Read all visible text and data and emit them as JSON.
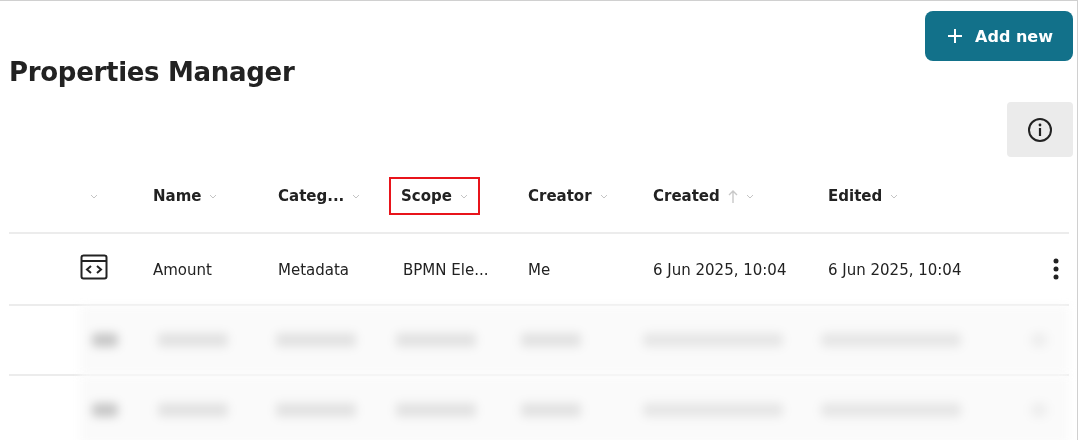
{
  "page": {
    "title": "Properties Manager"
  },
  "add_button": {
    "label": "Add new"
  },
  "table": {
    "columns": [
      {
        "sorted": false,
        "highlighted": false
      },
      {
        "label": "Name",
        "sorted": false,
        "highlighted": false
      },
      {
        "label": "Categ...",
        "sorted": false,
        "highlighted": false
      },
      {
        "label": "Scope",
        "sorted": false,
        "highlighted": true
      },
      {
        "label": "Creator",
        "sorted": false,
        "highlighted": false
      },
      {
        "label": "Created",
        "sorted": true,
        "highlighted": false
      },
      {
        "label": "Edited",
        "sorted": false,
        "highlighted": false
      }
    ],
    "rows": [
      {
        "kind": "data",
        "cells": [
          "Amount",
          "Metadata",
          "BPMN Ele...",
          "Me",
          "6 Jun 2025, 10:04",
          "6 Jun 2025, 10:04"
        ]
      },
      {
        "kind": "blurred"
      },
      {
        "kind": "blurred"
      }
    ]
  }
}
